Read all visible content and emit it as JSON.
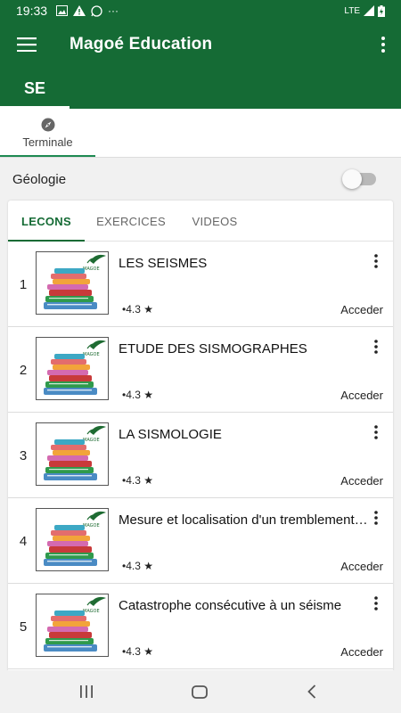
{
  "status_bar": {
    "time": "19:33",
    "network": "LTE",
    "more": "···"
  },
  "app": {
    "title": "Magoé Education"
  },
  "top_tabs": [
    {
      "label": "SE"
    }
  ],
  "sub_tabs": [
    {
      "label": "Terminale"
    }
  ],
  "subject": {
    "label": "Géologie",
    "toggle_on": false
  },
  "content_tabs": [
    {
      "label": "LECONS"
    },
    {
      "label": "EXERCICES"
    },
    {
      "label": "VIDEOS"
    }
  ],
  "active_content_tab": "LECONS",
  "lessons": [
    {
      "number": "1",
      "title": "LES SEISMES",
      "rating": "•4.3 ★",
      "action": "Acceder"
    },
    {
      "number": "2",
      "title": "ETUDE DES SISMOGRAPHES",
      "rating": "•4.3 ★",
      "action": "Acceder"
    },
    {
      "number": "3",
      "title": "LA SISMOLOGIE",
      "rating": "•4.3 ★",
      "action": "Acceder"
    },
    {
      "number": "4",
      "title": "Mesure  et localisation d'un tremblement de terre",
      "rating": "•4.3 ★",
      "action": "Acceder"
    },
    {
      "number": "5",
      "title": "Catastrophe consécutive à un séisme",
      "rating": "•4.3 ★",
      "action": "Acceder"
    }
  ],
  "thumbnail": {
    "brand": "MAGOE",
    "accent": "#1e6b32"
  },
  "colors": {
    "primary": "#156b35",
    "indicator": "#1e8a52"
  }
}
